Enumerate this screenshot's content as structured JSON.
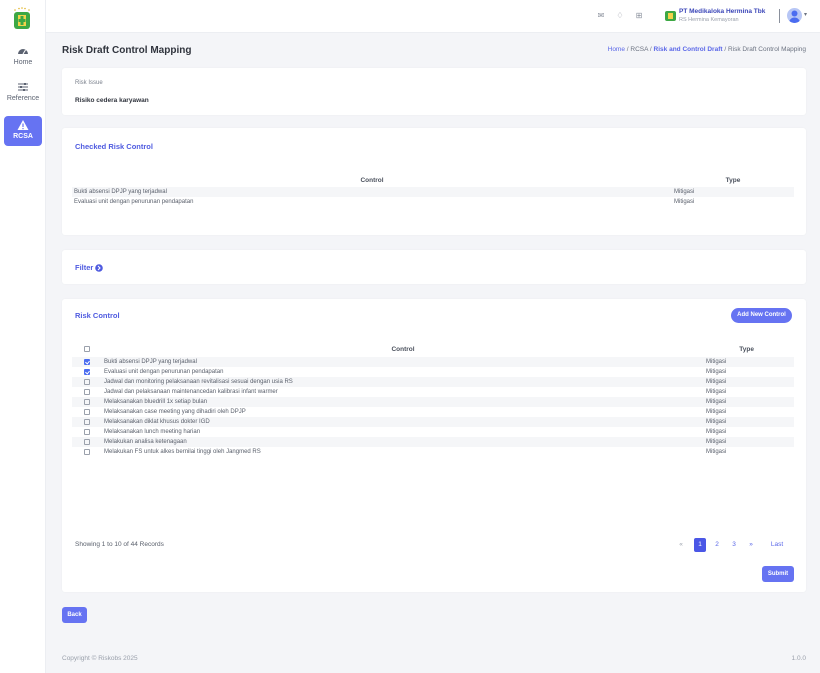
{
  "sidebar": {
    "items": [
      {
        "label": "Home",
        "icon": "dashboard-icon"
      },
      {
        "label": "Reference",
        "icon": "sliders-icon"
      },
      {
        "label": "RCSA",
        "icon": "warning-icon",
        "active": true
      }
    ]
  },
  "topbar": {
    "company_name": "PT Medikaloka Hermina Tbk",
    "company_unit": "RS Hermina Kemayoran"
  },
  "header": {
    "title": "Risk Draft Control Mapping",
    "breadcrumb": [
      "Home",
      "RCSA",
      "Risk and Control Draft",
      "Risk Draft Control Mapping"
    ]
  },
  "risk_issue": {
    "label": "Risk Issue",
    "value": "Risiko cedera karyawan"
  },
  "checked": {
    "title": "Checked Risk Control",
    "columns": [
      "Control",
      "Type"
    ],
    "rows": [
      {
        "control": "Bukti absensi DPJP yang terjadwal",
        "type": "Mitigasi"
      },
      {
        "control": "Evaluasi unit dengan penurunan pendapatan",
        "type": "Mitigasi"
      }
    ]
  },
  "filter": {
    "label": "Filter"
  },
  "risk_control": {
    "title": "Risk Control",
    "add_label": "Add New Control",
    "columns": [
      "Control",
      "Type"
    ],
    "rows": [
      {
        "control": "Bukti absensi DPJP yang terjadwal",
        "type": "Mitigasi",
        "checked": true
      },
      {
        "control": "Evaluasi unit dengan penurunan pendapatan",
        "type": "Mitigasi",
        "checked": true
      },
      {
        "control": "Jadwal dan monitoring pelaksanaan revitalisasi sesuai dengan usia RS",
        "type": "Mitigasi",
        "checked": false
      },
      {
        "control": "Jadwal dan pelaksanaan maintenancedan kalibrasi infant warmer",
        "type": "Mitigasi",
        "checked": false
      },
      {
        "control": "Melaksanakan bluedrill 1x setiap bulan",
        "type": "Mitigasi",
        "checked": false
      },
      {
        "control": "Melaksanakan case meeting yang dihadiri oleh DPJP",
        "type": "Mitigasi",
        "checked": false
      },
      {
        "control": "Melaksanakan diklat khusus dokter IGD",
        "type": "Mitigasi",
        "checked": false
      },
      {
        "control": "Melaksanakan lunch meeting harian",
        "type": "Mitigasi",
        "checked": false
      },
      {
        "control": "Melakukan analisa ketenagaan",
        "type": "Mitigasi",
        "checked": false
      },
      {
        "control": "Melakukan FS untuk alkes bernilai tinggi oleh Jangmed RS",
        "type": "Mitigasi",
        "checked": false
      }
    ],
    "showing": "Showing 1 to 10 of 44 Records",
    "pager": {
      "prev": "«",
      "pages": [
        "1",
        "2",
        "3"
      ],
      "next": "»",
      "last": "Last"
    },
    "submit_label": "Submit"
  },
  "back_label": "Back",
  "footer": {
    "copyright": "Copyright © Riskobs 2025",
    "version": "1.0.0"
  },
  "colors": {
    "accent": "#6673f2",
    "link": "#4f5be0"
  }
}
